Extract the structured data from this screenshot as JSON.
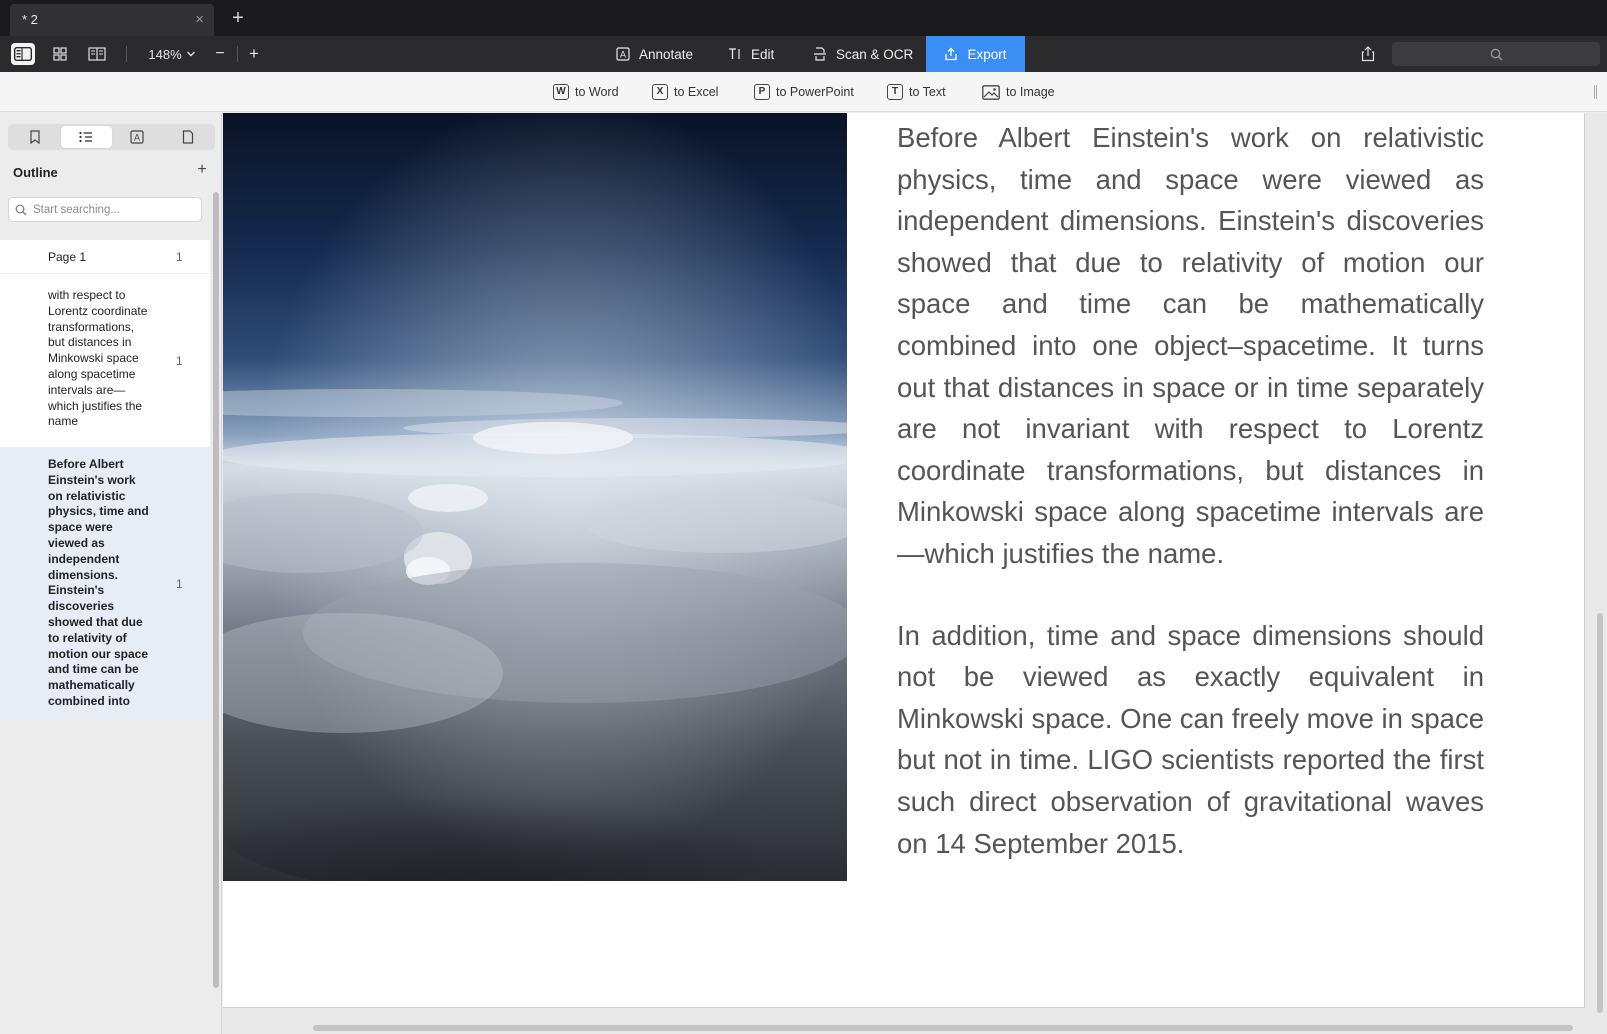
{
  "tabs": [
    {
      "title": "* 2",
      "close_label": "×"
    }
  ],
  "tab_add_label": "+",
  "toolbar": {
    "zoom": "148%",
    "zoom_minus": "−",
    "zoom_plus": "+",
    "modes": {
      "annotate": "Annotate",
      "edit": "Edit",
      "scan": "Scan & OCR",
      "export": "Export"
    },
    "active_mode": "Export",
    "accent_color": "#3a8ef6"
  },
  "export_bar": {
    "word": {
      "key": "W",
      "label": "to Word"
    },
    "excel": {
      "key": "X",
      "label": "to Excel"
    },
    "ppt": {
      "key": "P",
      "label": "to PowerPoint"
    },
    "text": {
      "key": "T",
      "label": "to Text"
    },
    "image": {
      "label": "to Image"
    }
  },
  "sidebar": {
    "title": "Outline",
    "add_label": "+",
    "search_placeholder": "Start searching...",
    "items": [
      {
        "text": "Page 1",
        "page": "1"
      },
      {
        "text": "with respect to Lorentz coordinate transformations, but distances in Minkowski space along spacetime intervals are—which justifies the name",
        "page": "1"
      },
      {
        "text": "Before Albert Einstein's work on relativistic physics, time and space were viewed as independent dimensions. Einstein's discoveries showed that due to relativity of motion our space and time can be mathematically combined into",
        "page": "1"
      }
    ]
  },
  "document": {
    "paragraphs": [
      "Before Albert Einstein's work on relativistic physics, time and space were viewed as independent dimensions. Einstein's discoveries showed that due to relativity of motion our space and time can be mathematically combined into one object–spacetime. It turns out that distances in space or in time separately are not invariant with respect to Lorentz coordinate transformations, but distances in Minkowski space along spacetime intervals are—which justifies the name.",
      "In addition, time and space dimensions should not be viewed as exactly equivalent in Minkowski space. One can freely move in space but not in time. LIGO scientists reported the first such direct observation of gravitational waves on 14 September 2015."
    ],
    "image": "cloud-sky-photo"
  }
}
